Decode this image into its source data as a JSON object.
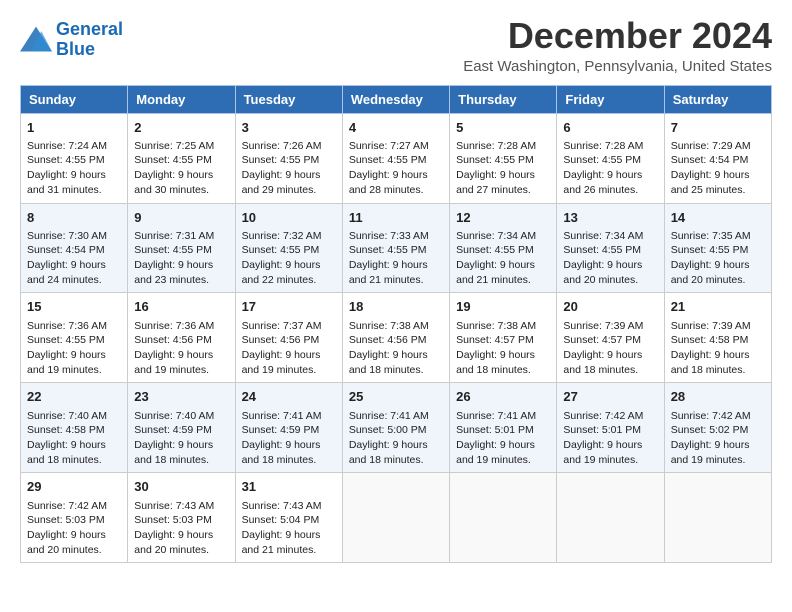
{
  "header": {
    "title": "December 2024",
    "location": "East Washington, Pennsylvania, United States",
    "logo_line1": "General",
    "logo_line2": "Blue"
  },
  "days_of_week": [
    "Sunday",
    "Monday",
    "Tuesday",
    "Wednesday",
    "Thursday",
    "Friday",
    "Saturday"
  ],
  "weeks": [
    [
      {
        "day": "1",
        "sunrise": "7:24 AM",
        "sunset": "4:55 PM",
        "daylight": "9 hours and 31 minutes."
      },
      {
        "day": "2",
        "sunrise": "7:25 AM",
        "sunset": "4:55 PM",
        "daylight": "9 hours and 30 minutes."
      },
      {
        "day": "3",
        "sunrise": "7:26 AM",
        "sunset": "4:55 PM",
        "daylight": "9 hours and 29 minutes."
      },
      {
        "day": "4",
        "sunrise": "7:27 AM",
        "sunset": "4:55 PM",
        "daylight": "9 hours and 28 minutes."
      },
      {
        "day": "5",
        "sunrise": "7:28 AM",
        "sunset": "4:55 PM",
        "daylight": "9 hours and 27 minutes."
      },
      {
        "day": "6",
        "sunrise": "7:28 AM",
        "sunset": "4:55 PM",
        "daylight": "9 hours and 26 minutes."
      },
      {
        "day": "7",
        "sunrise": "7:29 AM",
        "sunset": "4:54 PM",
        "daylight": "9 hours and 25 minutes."
      }
    ],
    [
      {
        "day": "8",
        "sunrise": "7:30 AM",
        "sunset": "4:54 PM",
        "daylight": "9 hours and 24 minutes."
      },
      {
        "day": "9",
        "sunrise": "7:31 AM",
        "sunset": "4:55 PM",
        "daylight": "9 hours and 23 minutes."
      },
      {
        "day": "10",
        "sunrise": "7:32 AM",
        "sunset": "4:55 PM",
        "daylight": "9 hours and 22 minutes."
      },
      {
        "day": "11",
        "sunrise": "7:33 AM",
        "sunset": "4:55 PM",
        "daylight": "9 hours and 21 minutes."
      },
      {
        "day": "12",
        "sunrise": "7:34 AM",
        "sunset": "4:55 PM",
        "daylight": "9 hours and 21 minutes."
      },
      {
        "day": "13",
        "sunrise": "7:34 AM",
        "sunset": "4:55 PM",
        "daylight": "9 hours and 20 minutes."
      },
      {
        "day": "14",
        "sunrise": "7:35 AM",
        "sunset": "4:55 PM",
        "daylight": "9 hours and 20 minutes."
      }
    ],
    [
      {
        "day": "15",
        "sunrise": "7:36 AM",
        "sunset": "4:55 PM",
        "daylight": "9 hours and 19 minutes."
      },
      {
        "day": "16",
        "sunrise": "7:36 AM",
        "sunset": "4:56 PM",
        "daylight": "9 hours and 19 minutes."
      },
      {
        "day": "17",
        "sunrise": "7:37 AM",
        "sunset": "4:56 PM",
        "daylight": "9 hours and 19 minutes."
      },
      {
        "day": "18",
        "sunrise": "7:38 AM",
        "sunset": "4:56 PM",
        "daylight": "9 hours and 18 minutes."
      },
      {
        "day": "19",
        "sunrise": "7:38 AM",
        "sunset": "4:57 PM",
        "daylight": "9 hours and 18 minutes."
      },
      {
        "day": "20",
        "sunrise": "7:39 AM",
        "sunset": "4:57 PM",
        "daylight": "9 hours and 18 minutes."
      },
      {
        "day": "21",
        "sunrise": "7:39 AM",
        "sunset": "4:58 PM",
        "daylight": "9 hours and 18 minutes."
      }
    ],
    [
      {
        "day": "22",
        "sunrise": "7:40 AM",
        "sunset": "4:58 PM",
        "daylight": "9 hours and 18 minutes."
      },
      {
        "day": "23",
        "sunrise": "7:40 AM",
        "sunset": "4:59 PM",
        "daylight": "9 hours and 18 minutes."
      },
      {
        "day": "24",
        "sunrise": "7:41 AM",
        "sunset": "4:59 PM",
        "daylight": "9 hours and 18 minutes."
      },
      {
        "day": "25",
        "sunrise": "7:41 AM",
        "sunset": "5:00 PM",
        "daylight": "9 hours and 18 minutes."
      },
      {
        "day": "26",
        "sunrise": "7:41 AM",
        "sunset": "5:01 PM",
        "daylight": "9 hours and 19 minutes."
      },
      {
        "day": "27",
        "sunrise": "7:42 AM",
        "sunset": "5:01 PM",
        "daylight": "9 hours and 19 minutes."
      },
      {
        "day": "28",
        "sunrise": "7:42 AM",
        "sunset": "5:02 PM",
        "daylight": "9 hours and 19 minutes."
      }
    ],
    [
      {
        "day": "29",
        "sunrise": "7:42 AM",
        "sunset": "5:03 PM",
        "daylight": "9 hours and 20 minutes."
      },
      {
        "day": "30",
        "sunrise": "7:43 AM",
        "sunset": "5:03 PM",
        "daylight": "9 hours and 20 minutes."
      },
      {
        "day": "31",
        "sunrise": "7:43 AM",
        "sunset": "5:04 PM",
        "daylight": "9 hours and 21 minutes."
      },
      null,
      null,
      null,
      null
    ]
  ]
}
